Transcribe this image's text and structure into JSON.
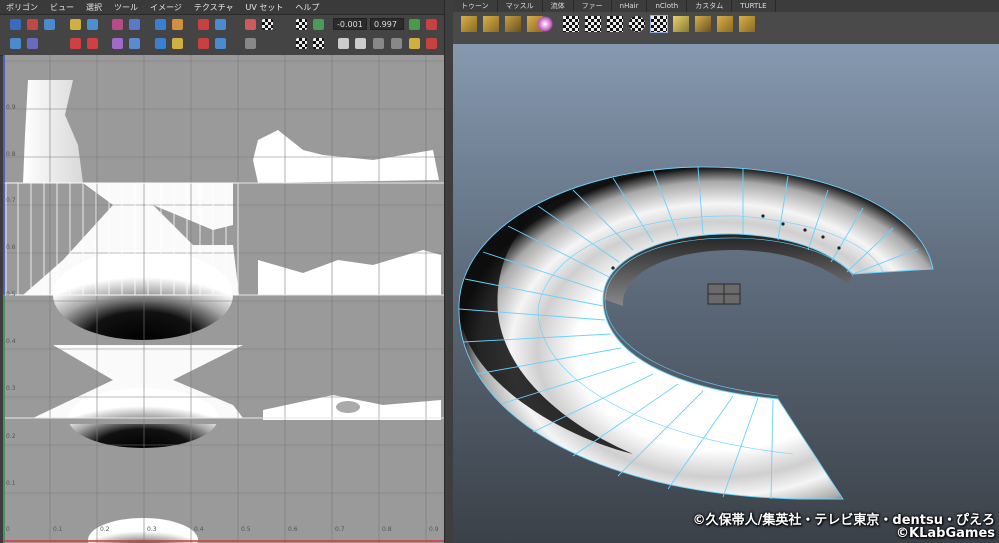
{
  "uv_editor": {
    "menu": [
      "ポリゴン",
      "ビュー",
      "選択",
      "ツール",
      "イメージ",
      "テクスチャ",
      "UV セット",
      "ヘルプ"
    ],
    "field_a": "-0.001",
    "field_b": "0.997",
    "ticks_y": [
      "0.9",
      "0.8",
      "0.7",
      "0.6",
      "0.5",
      "0.4",
      "0.3",
      "0.2",
      "0.1"
    ],
    "ticks_x": [
      "0",
      "0.1",
      "0.2",
      "0.3",
      "0.4",
      "0.5",
      "0.6",
      "0.7",
      "0.8",
      "0.9"
    ]
  },
  "shelf": {
    "tabs": [
      "トゥーン",
      "マッスル",
      "流体",
      "ファー",
      "nHair",
      "nCloth",
      "カスタム",
      "TURTLE"
    ]
  },
  "credits": {
    "line1": "©久保帯人/集英社・テレビ東京・dentsu・ぴえろ",
    "line2": "©KLabGames"
  },
  "colors": {
    "wireframe": "#66d2ff",
    "viewport_top": "#8699b0",
    "viewport_bottom": "#3b4148",
    "uv_canvas": "#9a9a9a"
  }
}
